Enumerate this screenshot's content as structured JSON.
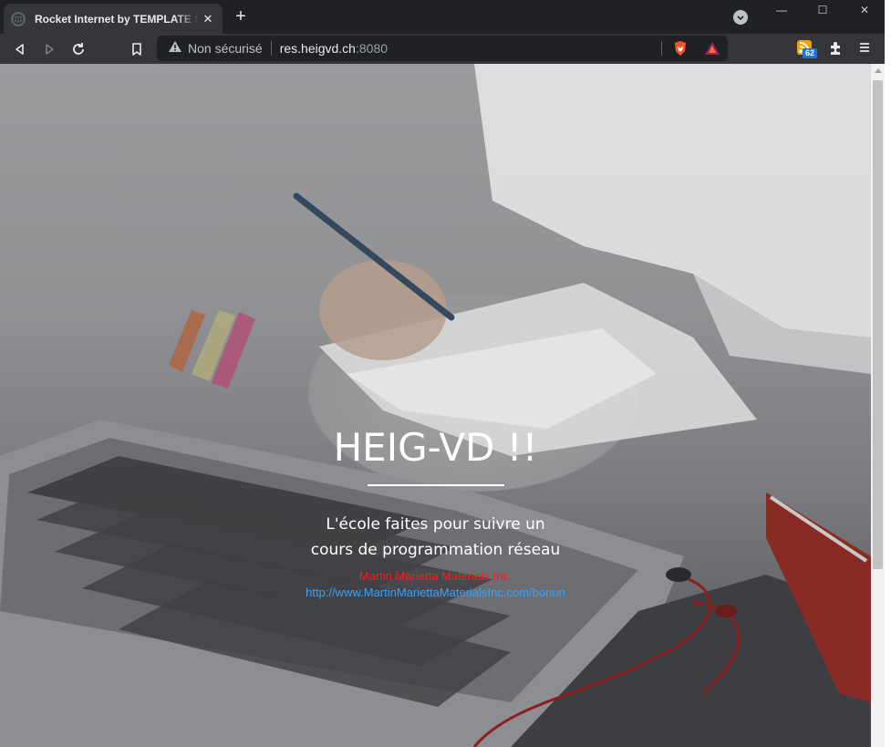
{
  "browser": {
    "tab": {
      "title": "Rocket Internet by TEMPLATE STOCK",
      "close": "✕"
    },
    "new_tab": "+",
    "window_controls": {
      "minimize": "—",
      "maximize": "☐",
      "close": "✕"
    },
    "address_bar": {
      "security_label": "Non sécurisé",
      "host": "res.heigvd.ch",
      "port": ":8080"
    },
    "rss_badge": "62",
    "accent_color": "#1a73e8"
  },
  "page": {
    "title": "HEIG-VD !!",
    "subtitle_line1": "L'école faites pour suivre un",
    "subtitle_line2": "cours de programmation réseau",
    "company": "Martin Marietta Materials Inc.",
    "link": "http://www.MartinMariettaMaterialsInc.com/bonun",
    "company_color": "#ff1a1a",
    "link_color": "#3aa0ff"
  }
}
